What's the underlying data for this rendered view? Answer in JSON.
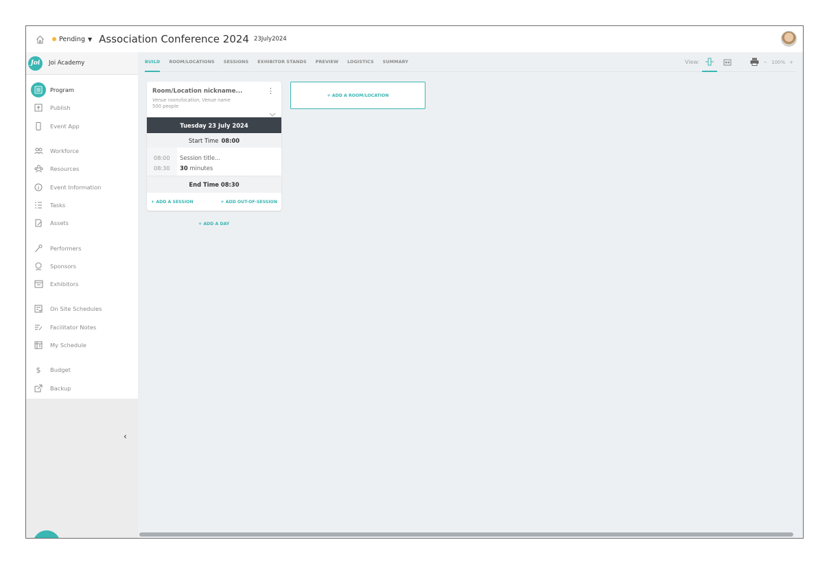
{
  "header": {
    "status": "Pending",
    "event_title": "Association Conference 2024",
    "event_date": "23July2024"
  },
  "sidebar": {
    "org_logo_text": "Joi",
    "org_name": "Joi Academy",
    "items": [
      {
        "label": "Program",
        "icon": "program-icon"
      },
      {
        "label": "Publish",
        "icon": "publish-icon"
      },
      {
        "label": "Event App",
        "icon": "phone-icon"
      },
      {
        "label": "Workforce",
        "icon": "people-icon"
      },
      {
        "label": "Resources",
        "icon": "resources-icon"
      },
      {
        "label": "Event Information",
        "icon": "info-icon"
      },
      {
        "label": "Tasks",
        "icon": "tasks-icon"
      },
      {
        "label": "Assets",
        "icon": "assets-icon"
      },
      {
        "label": "Performers",
        "icon": "microphone-icon"
      },
      {
        "label": "Sponsors",
        "icon": "sponsors-icon"
      },
      {
        "label": "Exhibitors",
        "icon": "exhibitors-icon"
      },
      {
        "label": "On Site Schedules",
        "icon": "onsite-schedule-icon"
      },
      {
        "label": "Facilitator Notes",
        "icon": "notes-icon"
      },
      {
        "label": "My Schedule",
        "icon": "my-schedule-icon"
      },
      {
        "label": "Budget",
        "icon": "dollar-icon"
      },
      {
        "label": "Backup",
        "icon": "backup-icon"
      }
    ]
  },
  "tabs": [
    "BUILD",
    "ROOM/LOCATIONS",
    "SESSIONS",
    "EXHIBITOR STANDS",
    "PREVIEW",
    "LOGISTICS",
    "SUMMARY"
  ],
  "toolbar": {
    "view_label": "View:",
    "zoom_minus": "−",
    "zoom_value": "100%",
    "zoom_plus": "+"
  },
  "room_card": {
    "nickname": "Room/Location nickname...",
    "venue": "Venue room/location, Venue name",
    "capacity": "500 people",
    "day": "Tuesday 23 July 2024",
    "start_label": "Start Time",
    "start_time": "08:00",
    "session": {
      "time_start": "08:00",
      "time_end": "08:30",
      "title": "Session title...",
      "duration_value": "30",
      "duration_unit": "minutes"
    },
    "end_text": "End Time 08:30",
    "add_session": "+ ADD A SESSION",
    "add_out_of_session": "+ ADD OUT-OF-SESSION"
  },
  "add_day": "+ ADD A DAY",
  "add_room": "+ ADD A ROOM/LOCATION",
  "colors": {
    "accent": "#3ab6b3",
    "pending": "#f5b73b",
    "day_bar": "#3c434b"
  }
}
